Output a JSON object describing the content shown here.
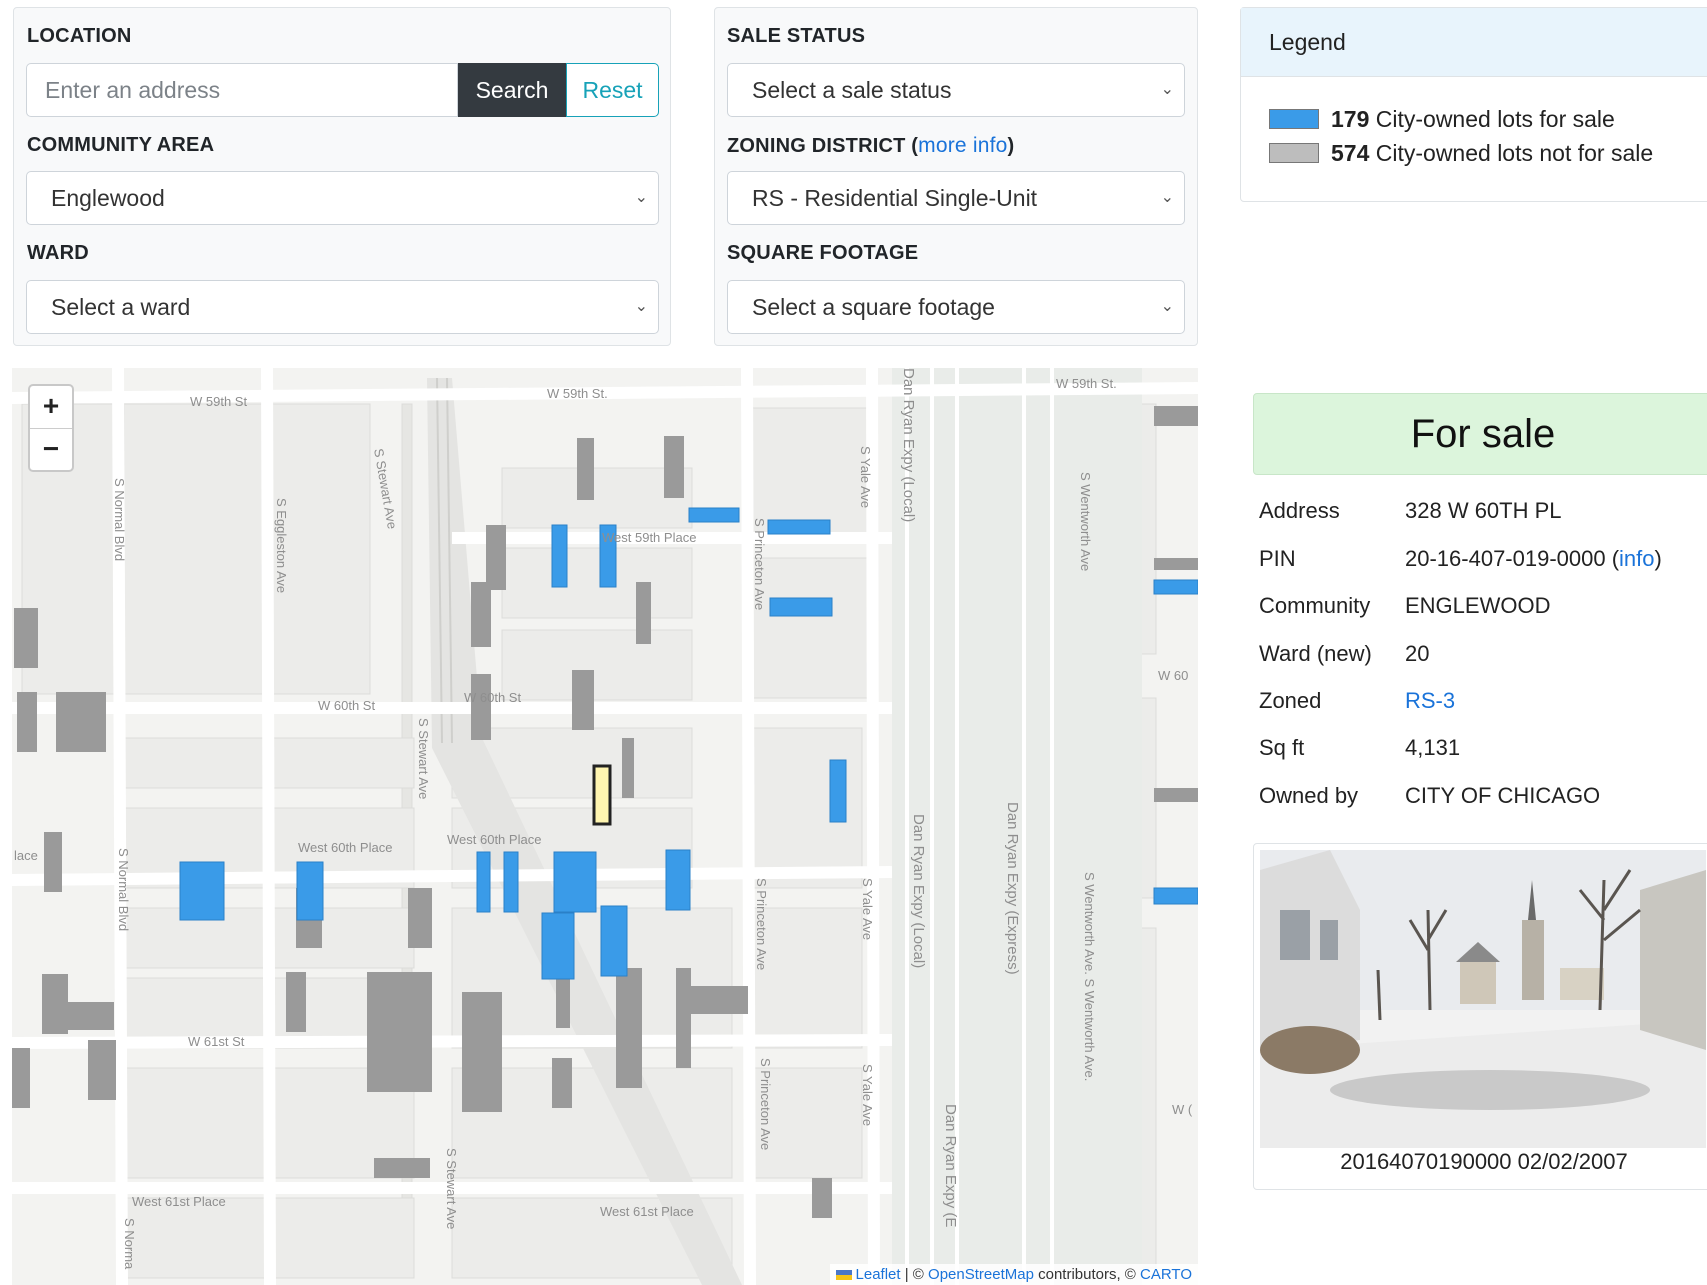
{
  "filters": {
    "location": {
      "label": "LOCATION",
      "placeholder": "Enter an address",
      "search_label": "Search",
      "reset_label": "Reset"
    },
    "community_area": {
      "label": "COMMUNITY AREA",
      "value": "Englewood"
    },
    "ward": {
      "label": "WARD",
      "value": "Select a ward"
    },
    "sale_status": {
      "label": "SALE STATUS",
      "value": "Select a sale status"
    },
    "zoning_district": {
      "label": "ZONING DISTRICT (",
      "link": "more info",
      "label_end": ")",
      "value": "RS - Residential Single-Unit"
    },
    "square_footage": {
      "label": "SQUARE FOOTAGE",
      "value": "Select a square footage"
    }
  },
  "legend": {
    "title": "Legend",
    "for_sale": {
      "count": "179",
      "text": " City-owned lots for sale",
      "color": "#3a9be8"
    },
    "not_for_sale": {
      "count": "574",
      "text": " City-owned lots not for sale",
      "color": "#bdbdbd"
    }
  },
  "map": {
    "zoom_in": "+",
    "zoom_out": "−",
    "attribution": {
      "leaflet": "Leaflet",
      "sep1": " | © ",
      "osm": "OpenStreetMap",
      "mid": " contributors, © ",
      "carto": "CARTO"
    },
    "street_labels": {
      "w59_a": "W 59th St",
      "w59_b": "W 59th St.",
      "w59_c": "W 59th St.",
      "west59pl": "West 59th Place",
      "w60_a": "W 60th St",
      "w60_b": "W 60th St",
      "west60pl_a": "West 60th Place",
      "west60pl_b": "West 60th Place",
      "w61": "W 61st St",
      "west61pl_a": "West 61st Place",
      "west61pl_b": "West 61st Place",
      "normal": "S Normal Blvd",
      "normal2": "S Normal Blvd",
      "eggleston": "S Eggleston Ave",
      "stewart_a": "S Stewart Ave",
      "stewart_b": "S Stewart Ave",
      "stewart_c": "S Stewart Ave",
      "princeton_a": "S Princeton Ave",
      "princeton_b": "S Princeton Ave",
      "princeton_c": "S Princeton Ave",
      "yale_a": "S Yale Ave",
      "yale_b": "S Yale Ave",
      "yale_c": "S Yale Ave",
      "ryan_local_a": "Dan Ryan Expy (Local)",
      "ryan_local_b": "Dan Ryan Expy (Local)",
      "ryan_express": "Dan Ryan Expy (Express)",
      "ryan_e": "Dan Ryan Expy (E",
      "wentworth_a": "S Wentworth Ave",
      "wentworth_b": "S Wentworth Ave. S Wentworth Ave.",
      "w60_edge": "W 60",
      "place_edge": "lace",
      "w_edge": "W (",
      "normal_edge": "S Norma"
    }
  },
  "parcel": {
    "status": "For sale",
    "rows": [
      {
        "label": "Address",
        "value": "328 W 60TH PL"
      },
      {
        "label": "PIN",
        "value": "20-16-407-019-0000 (",
        "link": "info",
        "value_end": ")"
      },
      {
        "label": "Community",
        "value": "ENGLEWOOD"
      },
      {
        "label": "Ward (new)",
        "value": "20"
      },
      {
        "label": "Zoned",
        "value": "RS-3"
      },
      {
        "label": "Sq ft",
        "value": "4,131"
      },
      {
        "label": "Owned by",
        "value": "CITY OF CHICAGO"
      }
    ],
    "photo_caption": "20164070190000  02/02/2007"
  }
}
